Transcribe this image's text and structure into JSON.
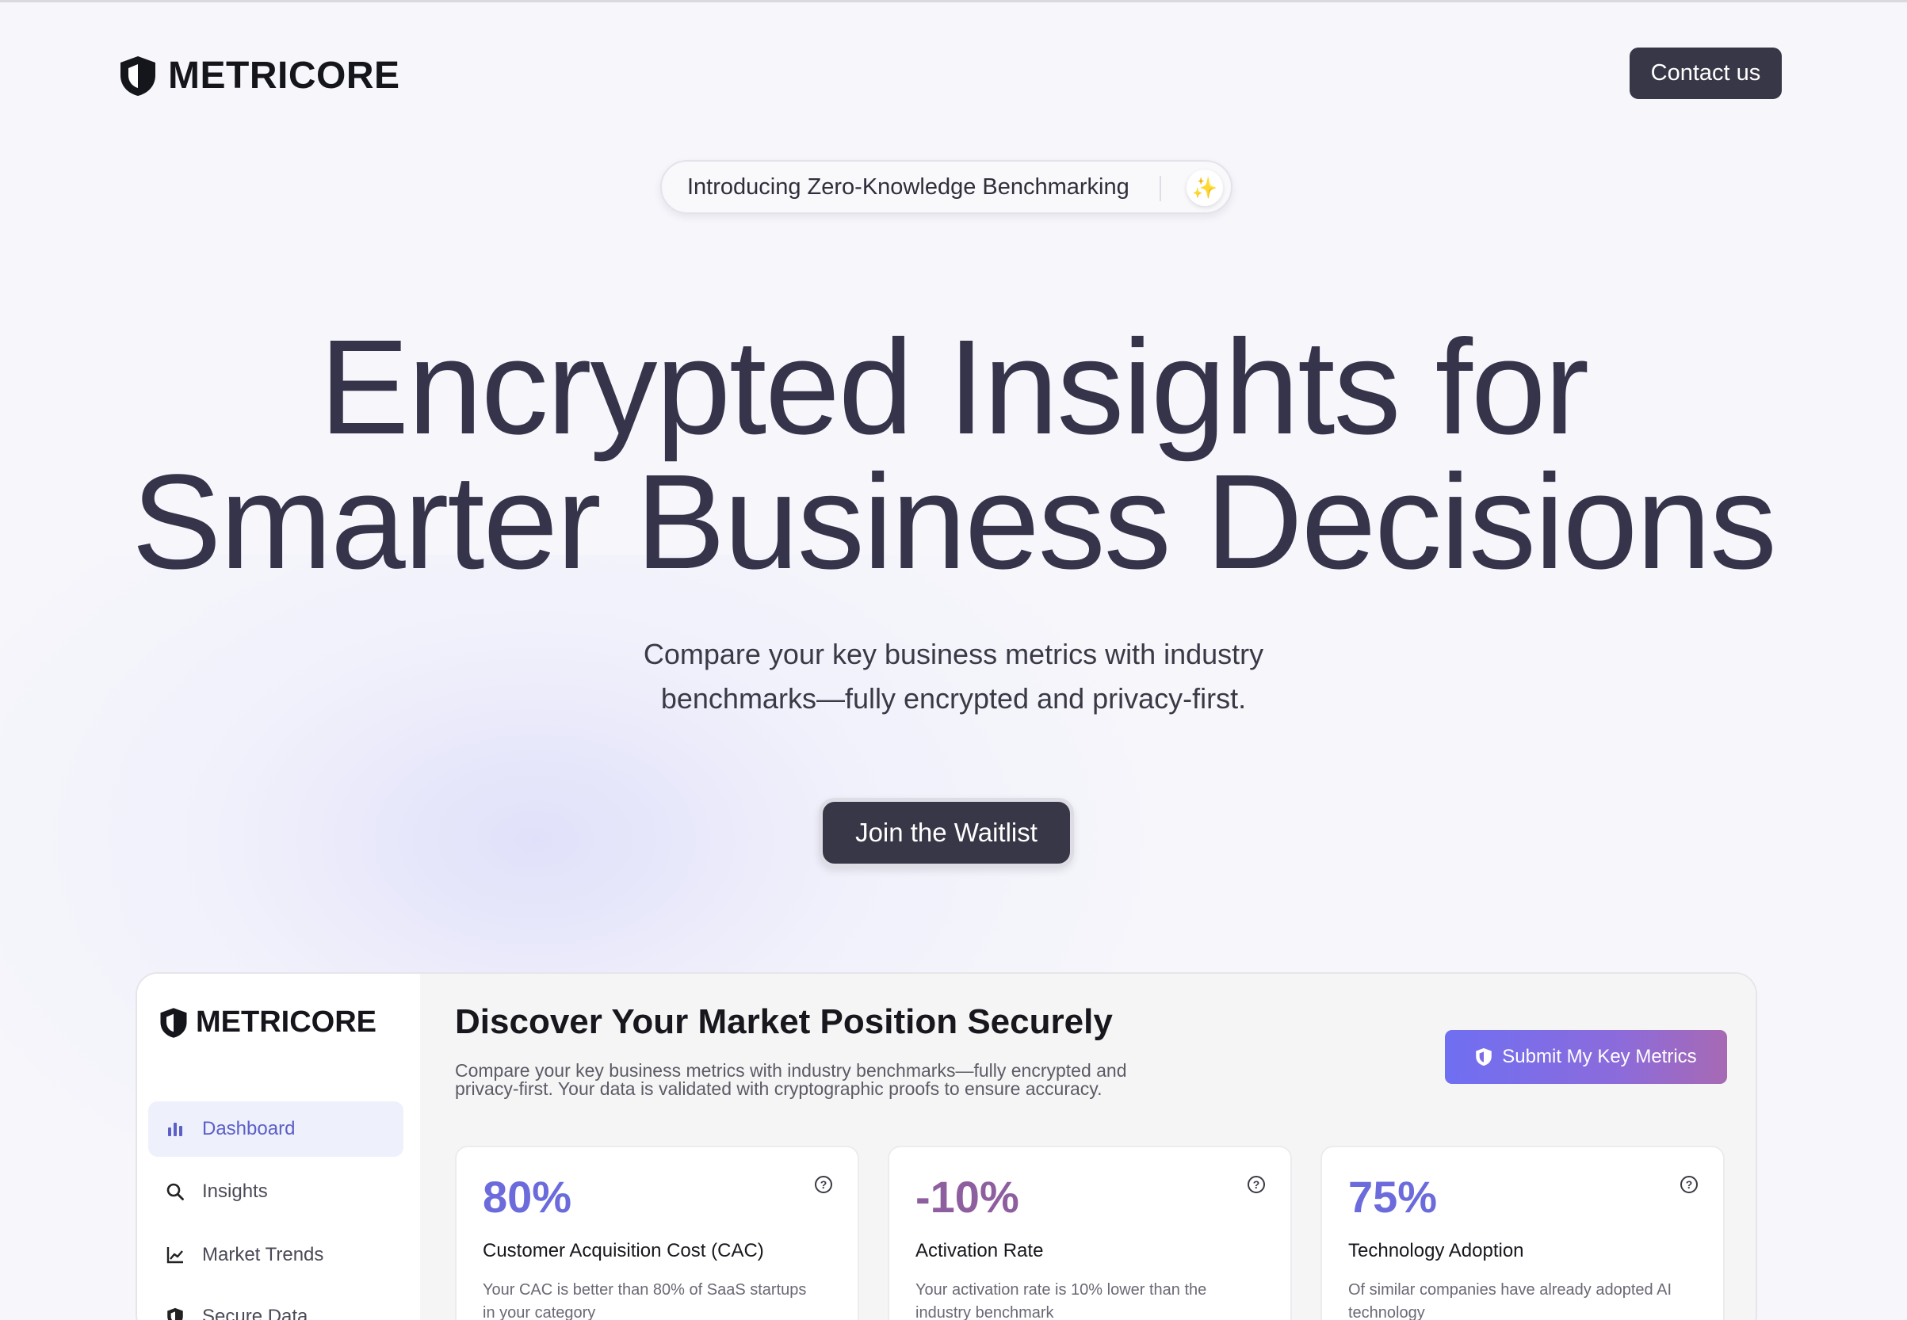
{
  "header": {
    "brand": "METRICORE",
    "contact_label": "Contact us"
  },
  "announcement": {
    "text": "Introducing Zero-Knowledge Benchmarking",
    "icon": "sparkles-icon"
  },
  "hero": {
    "title_line1": "Encrypted Insights for",
    "title_line2": "Smarter Business Decisions",
    "subtitle_line1": "Compare your key business metrics with industry",
    "subtitle_line2": "benchmarks—fully encrypted and privacy-first.",
    "cta_label": "Join the Waitlist"
  },
  "app_preview": {
    "brand": "METRICORE",
    "nav": [
      {
        "label": "Dashboard",
        "icon": "bar-chart-icon",
        "active": true
      },
      {
        "label": "Insights",
        "icon": "search-icon",
        "active": false
      },
      {
        "label": "Market Trends",
        "icon": "line-chart-icon",
        "active": false
      },
      {
        "label": "Secure Data",
        "icon": "shield-icon",
        "active": false
      }
    ],
    "title": "Discover Your Market Position Securely",
    "description_line1": "Compare your key business metrics with industry benchmarks—fully encrypted and",
    "description_line2": "privacy-first. Your data is validated with cryptographic proofs to ensure accuracy.",
    "submit_label": "Submit My Key Metrics",
    "cards": [
      {
        "value": "80%",
        "label": "Customer Acquisition Cost (CAC)",
        "desc_line1": "Your CAC is better than 80% of SaaS startups",
        "desc_line2": "in your category",
        "color": "#6b6bdc"
      },
      {
        "value": "-10%",
        "label": "Activation Rate",
        "desc_line1": "Your activation rate is 10% lower than the",
        "desc_line2": "industry benchmark",
        "color": "#8e5f9e"
      },
      {
        "value": "75%",
        "label": "Technology Adoption",
        "desc_line1": "Of similar companies have already adopted AI",
        "desc_line2": "technology",
        "color": "#6b6bdc"
      }
    ]
  },
  "colors": {
    "dark_button": "#383747",
    "accent": "#6b6bdc",
    "background": "#f6f6fb"
  }
}
